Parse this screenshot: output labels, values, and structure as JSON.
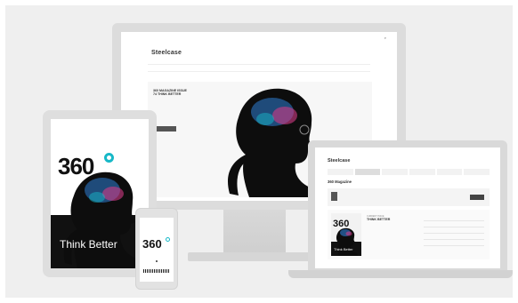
{
  "desktop": {
    "topbar_links": [
      "",
      "",
      "",
      ""
    ],
    "logo": "Steelcase",
    "nav": [
      "",
      "",
      "",
      "",
      "",
      ""
    ],
    "hero": {
      "title": "360 MAGAZINE ISSUE 74 THINK BETTER",
      "body": "",
      "button": ""
    }
  },
  "tablet": {
    "columns": [
      "",
      "",
      "",
      ""
    ],
    "brand": "360",
    "headline": "Think Better",
    "subline": ""
  },
  "phone": {
    "logo": "",
    "brand": "360"
  },
  "laptop": {
    "logo": "Steelcase",
    "topbar_links": [
      "",
      "",
      ""
    ],
    "nav": [
      "",
      "",
      "",
      "",
      "",
      ""
    ],
    "title": "360 Magazine",
    "title_sub": "",
    "banner_text": "",
    "banner_logo": "",
    "cover_brand": "360",
    "cover_headline": "Think Better",
    "issue_label": "CURRENT ISSUE",
    "issue_title": "THINK BETTER",
    "list_items": [
      "",
      "",
      "",
      "",
      ""
    ],
    "footer_text": ""
  },
  "colors": {
    "accent": "#17b8c7",
    "brain_blue": "#2f7fd6",
    "brain_pink": "#d23a86"
  }
}
